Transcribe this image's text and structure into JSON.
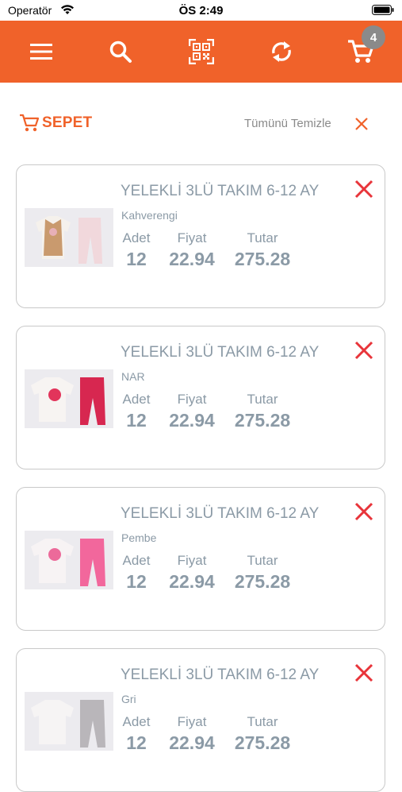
{
  "status_bar": {
    "carrier": "Operatör",
    "time": "ÖS 2:49"
  },
  "toolbar": {
    "accent_color": "#f0622a",
    "icons": [
      "menu-icon",
      "search-icon",
      "qr-scan-icon",
      "refresh-icon",
      "cart-icon"
    ],
    "cart_count": "4"
  },
  "cart_header": {
    "title": "SEPET",
    "clear_all": "Tümünü Temizle"
  },
  "columns": {
    "qty": "Adet",
    "price": "Fiyat",
    "total": "Tutar"
  },
  "items": [
    {
      "name": "YELEKLİ 3LÜ TAKIM 6-12 AY",
      "color": "Kahverengi",
      "qty": "12",
      "price": "22.94",
      "total": "275.28"
    },
    {
      "name": "YELEKLİ 3LÜ TAKIM 6-12 AY",
      "color": "NAR",
      "qty": "12",
      "price": "22.94",
      "total": "275.28"
    },
    {
      "name": "YELEKLİ 3LÜ TAKIM 6-12 AY",
      "color": "Pembe",
      "qty": "12",
      "price": "22.94",
      "total": "275.28"
    },
    {
      "name": "YELEKLİ 3LÜ TAKIM 6-12 AY",
      "color": "Gri",
      "qty": "12",
      "price": "22.94",
      "total": "275.28"
    }
  ]
}
